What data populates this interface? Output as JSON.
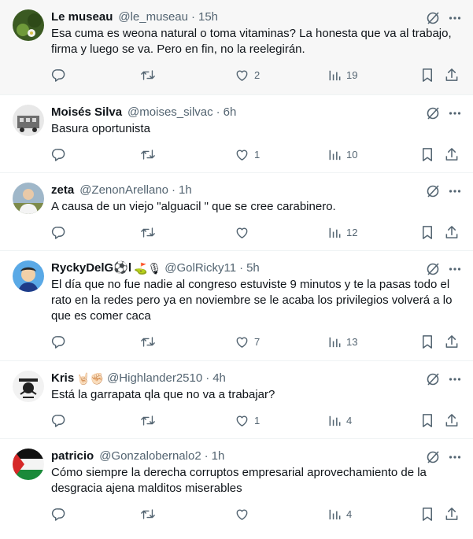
{
  "tweets": [
    {
      "name": "Le museau",
      "emoji": "",
      "handle": "@le_museau",
      "time": "15h",
      "text": "Esa cuma es weona natural o toma vitaminas? La honesta que va al trabajo, firma y luego se va. Pero en fin, no la reelegirán.",
      "replies": "",
      "retweets": "",
      "likes": "2",
      "views": "19",
      "highlighted": true
    },
    {
      "name": "Moisés Silva",
      "emoji": "",
      "handle": "@moises_silvac",
      "time": "6h",
      "text": "Basura oportunista",
      "replies": "",
      "retweets": "",
      "likes": "1",
      "views": "10"
    },
    {
      "name": "zeta",
      "emoji": "",
      "handle": "@ZenonArellano",
      "time": "1h",
      "text": "A causa de un viejo \"alguacil \" que se cree carabinero.",
      "replies": "",
      "retweets": "",
      "likes": "",
      "views": "12"
    },
    {
      "name": "RyckyDelG⚽l",
      "emoji": "⛳🎙",
      "handle": "@GolRicky11",
      "time": "5h",
      "text": "El día que no fue nadie al congreso estuviste 9 minutos y te la pasas todo el rato en la redes pero ya en noviembre se le acaba los privilegios volverá a lo que es comer caca",
      "replies": "",
      "retweets": "",
      "likes": "7",
      "views": "13"
    },
    {
      "name": "Kris",
      "emoji": "🤘🏻✊🏻",
      "handle": "@Highlander2510",
      "time": "4h",
      "text": "Está la garrapata qla que no va a trabajar?",
      "replies": "",
      "retweets": "",
      "likes": "1",
      "views": "4"
    },
    {
      "name": "patricio",
      "emoji": "",
      "handle": "@Gonzalobernalo2",
      "time": "1h",
      "text": "Cómo siempre la derecha corruptos empresarial aprovechamiento de la desgracia ajena malditos miserables",
      "replies": "",
      "retweets": "",
      "likes": "",
      "views": "4"
    }
  ],
  "icons": {
    "grok": "grok-icon",
    "more": "more-icon",
    "reply": "reply-icon",
    "retweet": "retweet-icon",
    "like": "like-icon",
    "views": "views-icon",
    "bookmark": "bookmark-icon",
    "share": "share-icon"
  },
  "colors": {
    "text": "#0f1419",
    "muted": "#536471",
    "highlight_bg": "#f7f7f7",
    "border": "#eff3f4"
  }
}
